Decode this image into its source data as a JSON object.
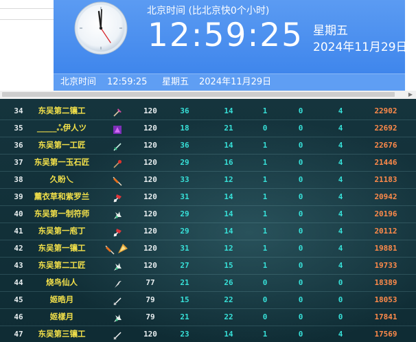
{
  "clock": {
    "title": "北京时间 (比北京快0个小时)",
    "time": "12:59:25",
    "weekday": "星期五",
    "date": "2024年11月29日",
    "status_label": "北京时间",
    "status_time": "12:59:25",
    "status_weekday": "星期五",
    "status_date": "2024年11月29日"
  },
  "colors": {
    "widget_blue": "#4f93f0",
    "name_yellow": "#f2e04a",
    "value_cyan": "#37e0d8",
    "score_orange": "#ff8a4a"
  },
  "ranking": {
    "rows": [
      {
        "rank": "34",
        "name": "东吴第二镶工",
        "items": [
          "pick-icon"
        ],
        "level": "120",
        "v1": "36",
        "v2": "14",
        "v3": "1",
        "v4": "0",
        "v5": "4",
        "score": "22902"
      },
      {
        "rank": "35",
        "name": "_____ஃ伊人ツ",
        "items": [
          "purple-gem-icon"
        ],
        "level": "120",
        "v1": "18",
        "v2": "21",
        "v3": "0",
        "v4": "0",
        "v5": "4",
        "score": "22692"
      },
      {
        "rank": "36",
        "name": "东吴第一工匠",
        "items": [
          "green-sword-icon"
        ],
        "level": "120",
        "v1": "36",
        "v2": "14",
        "v3": "1",
        "v4": "0",
        "v5": "4",
        "score": "22676"
      },
      {
        "rank": "37",
        "name": "东吴第一玉石匠",
        "items": [
          "red-staff-icon"
        ],
        "level": "120",
        "v1": "29",
        "v2": "16",
        "v3": "1",
        "v4": "0",
        "v5": "4",
        "score": "21446"
      },
      {
        "rank": "38",
        "name": "久盼乀",
        "items": [
          "orange-blade-icon"
        ],
        "level": "120",
        "v1": "33",
        "v2": "12",
        "v3": "1",
        "v4": "0",
        "v5": "4",
        "score": "21183"
      },
      {
        "rank": "39",
        "name": "薰衣草和紫罗兰",
        "items": [
          "red-axe-icon"
        ],
        "level": "120",
        "v1": "31",
        "v2": "14",
        "v3": "1",
        "v4": "0",
        "v5": "4",
        "score": "20942"
      },
      {
        "rank": "40",
        "name": "东吴第一制符师",
        "items": [
          "white-claw-icon"
        ],
        "level": "120",
        "v1": "29",
        "v2": "14",
        "v3": "1",
        "v4": "0",
        "v5": "4",
        "score": "20196"
      },
      {
        "rank": "41",
        "name": "东吴第一庖丁",
        "items": [
          "red-axe-icon"
        ],
        "level": "120",
        "v1": "29",
        "v2": "14",
        "v3": "1",
        "v4": "0",
        "v5": "4",
        "score": "20112"
      },
      {
        "rank": "42",
        "name": "东吴第一镶工",
        "items": [
          "orange-blade-icon",
          "golden-fan-icon"
        ],
        "level": "120",
        "v1": "31",
        "v2": "12",
        "v3": "1",
        "v4": "0",
        "v5": "4",
        "score": "19881"
      },
      {
        "rank": "43",
        "name": "东吴第二工匠",
        "items": [
          "white-claw-icon"
        ],
        "level": "120",
        "v1": "27",
        "v2": "15",
        "v3": "1",
        "v4": "0",
        "v5": "4",
        "score": "19733"
      },
      {
        "rank": "44",
        "name": "烧鸟仙人",
        "items": [
          "sickle-icon"
        ],
        "level": "77",
        "v1": "21",
        "v2": "26",
        "v3": "0",
        "v4": "0",
        "v5": "0",
        "score": "18389"
      },
      {
        "rank": "45",
        "name": "姬晧月",
        "items": [
          "white-sword-icon"
        ],
        "level": "79",
        "v1": "15",
        "v2": "22",
        "v3": "0",
        "v4": "0",
        "v5": "0",
        "score": "18053"
      },
      {
        "rank": "46",
        "name": "姬樣月",
        "items": [
          "white-claw-icon"
        ],
        "level": "79",
        "v1": "21",
        "v2": "22",
        "v3": "0",
        "v4": "0",
        "v5": "0",
        "score": "17841"
      },
      {
        "rank": "47",
        "name": "东吴第三镶工",
        "items": [
          "white-sword-icon"
        ],
        "level": "120",
        "v1": "23",
        "v2": "14",
        "v3": "1",
        "v4": "0",
        "v5": "4",
        "score": "17569"
      }
    ]
  }
}
